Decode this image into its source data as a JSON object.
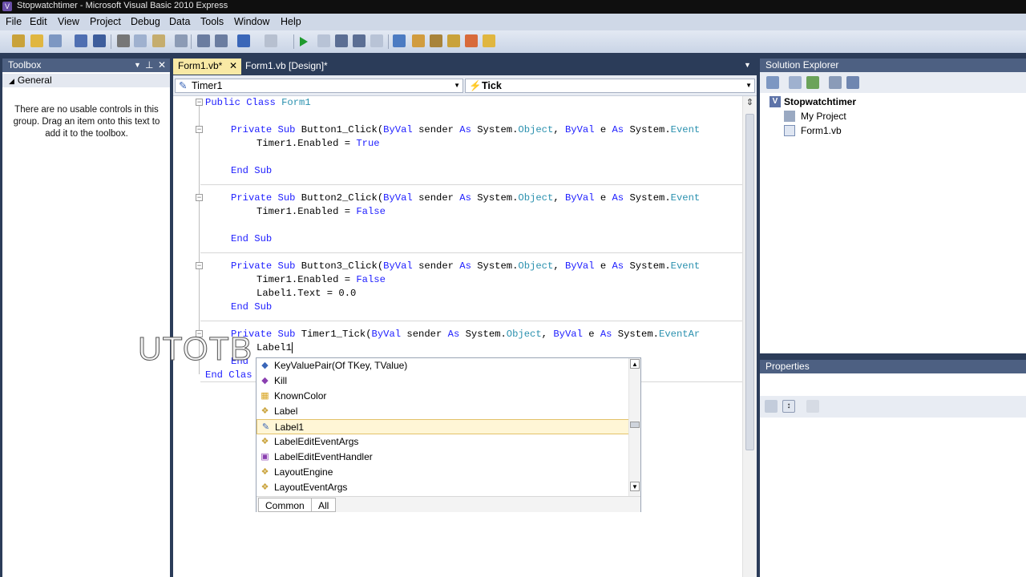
{
  "window": {
    "title": "Stopwatchtimer - Microsoft Visual Basic 2010 Express",
    "app_icon": "vb-icon"
  },
  "menu": [
    "File",
    "Edit",
    "View",
    "Project",
    "Debug",
    "Data",
    "Tools",
    "Window",
    "Help"
  ],
  "toolbox": {
    "title": "Toolbox",
    "group": "General",
    "empty_message": "There are no usable controls in this group. Drag an item onto this text to add it to the toolbox.",
    "pin_icon": "pin-icon",
    "close_icon": "close-icon"
  },
  "editor": {
    "tabs": [
      {
        "label": "Form1.vb*",
        "active": true
      },
      {
        "label": "Form1.vb [Design]*",
        "active": false
      }
    ],
    "object_combo": "Timer1",
    "event_combo": "Tick",
    "code": {
      "l1_kw": "Public Class",
      "l1_name": " Form1",
      "b1_private": "Private Sub",
      "b1_name": " Button1_Click(",
      "b1_byval": "ByVal",
      "b1_sender": " sender ",
      "b1_as": "As",
      "b1_sys": " System.",
      "b1_obj": "Object",
      "b1_comma": ", ",
      "b1_byval2": "ByVal",
      "b1_e": " e ",
      "b1_as2": "As",
      "b1_sys2": " System.",
      "b1_evt": "Event",
      "b1_body": "Timer1.Enabled = ",
      "b1_val": "True",
      "b1_end": "End Sub",
      "b2_name": " Button2_Click(",
      "b2_body": "Timer1.Enabled = ",
      "b2_val": "False",
      "b2_end": "End Sub",
      "b3_name": " Button3_Click(",
      "b3_body1": "Timer1.Enabled = ",
      "b3_val": "False",
      "b3_body2": "Label1.Text = 0.0",
      "b3_end": "End Sub",
      "b4_name": " Timer1_Tick(",
      "b4_evt": "EventAr",
      "b4_body": "Label1",
      "b4_end": "End",
      "class_end": "End Clas"
    }
  },
  "intellisense": {
    "items": [
      {
        "label": "KeyValuePair(Of TKey, TValue)",
        "icon": "structure-icon"
      },
      {
        "label": "Kill",
        "icon": "method-icon"
      },
      {
        "label": "KnownColor",
        "icon": "enum-icon"
      },
      {
        "label": "Label",
        "icon": "class-icon"
      },
      {
        "label": "Label1",
        "icon": "field-icon",
        "selected": true
      },
      {
        "label": "LabelEditEventArgs",
        "icon": "class-icon"
      },
      {
        "label": "LabelEditEventHandler",
        "icon": "delegate-icon"
      },
      {
        "label": "LayoutEngine",
        "icon": "class-icon"
      },
      {
        "label": "LayoutEventArgs",
        "icon": "class-icon"
      }
    ],
    "tabs": [
      "Common",
      "All"
    ]
  },
  "solution_explorer": {
    "title": "Solution Explorer",
    "project": "Stopwatchtimer",
    "children": [
      "My Project",
      "Form1.vb"
    ]
  },
  "properties": {
    "title": "Properties"
  },
  "watermark": "UTOTB",
  "colors": {
    "keyword": "#2020ff",
    "type": "#2b91af",
    "panel_header": "#4d6082",
    "chrome": "#2b3c59"
  }
}
